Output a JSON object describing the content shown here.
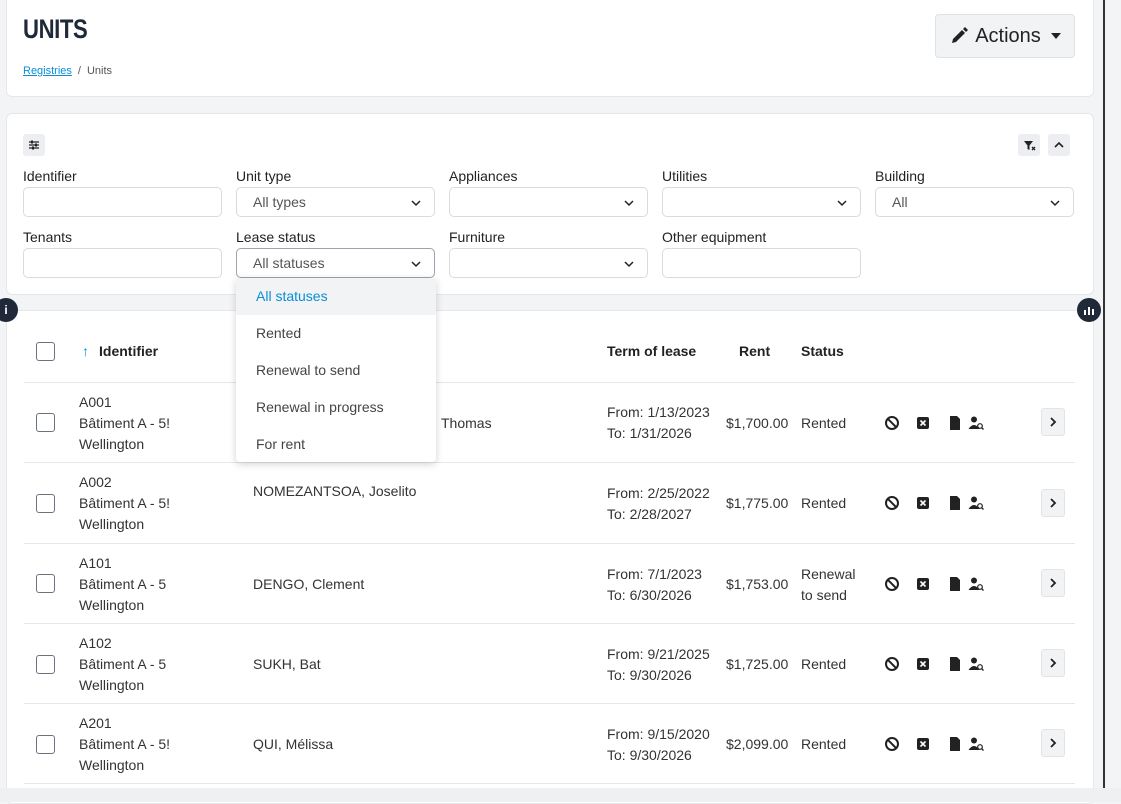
{
  "header": {
    "title": "UNITS",
    "breadcrumb": {
      "link": "Registries",
      "separator": "/",
      "current": "Units"
    },
    "actions_label": "Actions"
  },
  "filters": {
    "identifier_label": "Identifier",
    "unit_type_label": "Unit type",
    "unit_type_value": "All types",
    "appliances_label": "Appliances",
    "utilities_label": "Utilities",
    "building_label": "Building",
    "building_value": "All",
    "tenants_label": "Tenants",
    "lease_status_label": "Lease status",
    "lease_status_value": "All statuses",
    "furniture_label": "Furniture",
    "other_equipment_label": "Other equipment"
  },
  "lease_status_options": [
    "All statuses",
    "Rented",
    "Renewal to send",
    "Renewal in progress",
    "For rent"
  ],
  "badges": {
    "info": "i"
  },
  "table": {
    "headers": {
      "identifier": "Identifier",
      "term": "Term of lease",
      "rent": "Rent",
      "status": "Status"
    },
    "rows": [
      {
        "id": "A001",
        "building": "Bâtiment A - 5!",
        "city": "Wellington",
        "tenant": "Thomas",
        "from": "From: 1/13/2023",
        "to": "To: 1/31/2026",
        "rent": "$1,700.00",
        "status": "Rented"
      },
      {
        "id": "A002",
        "building": "Bâtiment A - 5!",
        "city": "Wellington",
        "tenant": "NOMEZANTSOA, Joselito",
        "from": "From: 2/25/2022",
        "to": "To: 2/28/2027",
        "rent": "$1,775.00",
        "status": "Rented"
      },
      {
        "id": "A101",
        "building": "Bâtiment A - 5",
        "city": "Wellington",
        "tenant": "DENGO, Clement",
        "from": "From: 7/1/2023",
        "to": "To: 6/30/2026",
        "rent": "$1,753.00",
        "status": "Renewal to send"
      },
      {
        "id": "A102",
        "building": "Bâtiment A - 5",
        "city": "Wellington",
        "tenant": "SUKH, Bat",
        "from": "From: 9/21/2025",
        "to": "To: 9/30/2026",
        "rent": "$1,725.00",
        "status": "Rented"
      },
      {
        "id": "A201",
        "building": "Bâtiment A - 5!",
        "city": "Wellington",
        "tenant": "QUI, Mélissa",
        "from": "From: 9/15/2020",
        "to": "To: 9/30/2026",
        "rent": "$2,099.00",
        "status": "Rented"
      }
    ]
  },
  "colors": {
    "accent": "#0a8ed6",
    "dark": "#1f2937"
  }
}
